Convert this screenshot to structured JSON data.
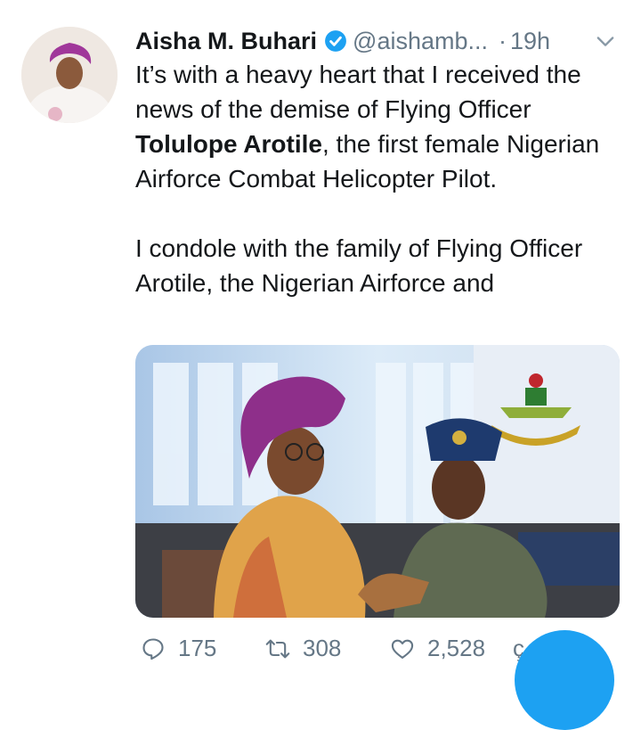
{
  "tweet": {
    "author_name": "Aisha M. Buhari",
    "handle": "@aishamb...",
    "separator": "·",
    "time": "19h",
    "text_line1_before": "It’s with a heavy heart that I received the news of the demise of Flying Officer ",
    "text_line1_bold": "Tolulope Arotile",
    "text_line1_after": ", the first female Nigerian Airforce Combat Helicopter Pilot.",
    "text_para2": "I condole with the family of Flying Officer Arotile, the Nigerian Airforce and"
  },
  "actions": {
    "reply_count": "175",
    "retweet_count": "308",
    "like_count": "2,528",
    "share_partial": "ç"
  },
  "icons": {
    "verified": "verified-badge-icon",
    "chevron": "chevron-down-icon",
    "reply": "reply-icon",
    "retweet": "retweet-icon",
    "like": "heart-icon"
  },
  "colors": {
    "accent": "#1da1f2",
    "secondary_text": "#657786",
    "primary_text": "#14171a"
  }
}
